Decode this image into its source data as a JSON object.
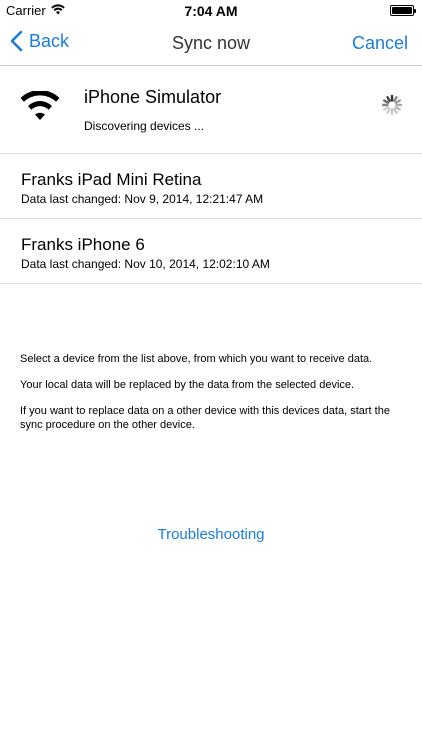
{
  "status_bar": {
    "carrier": "Carrier",
    "time": "7:04 AM",
    "battery_level": 1.0
  },
  "nav": {
    "back_label": "Back",
    "title": "Sync now",
    "cancel_label": "Cancel"
  },
  "current_device": {
    "name": "iPhone Simulator",
    "status": "Discovering devices ..."
  },
  "devices": [
    {
      "name": "Franks iPad Mini Retina",
      "last_changed": "Data last changed: Nov 9, 2014, 12:21:47 AM"
    },
    {
      "name": "Franks iPhone 6",
      "last_changed": "Data last changed: Nov 10, 2014, 12:02:10 AM"
    }
  ],
  "instructions": [
    "Select a device from the list above, from which you want to receive data.",
    "Your local data will be replaced by the data from the selected device.",
    "If you want to replace data on a other device with this devices data, start the sync procedure on the other device."
  ],
  "troubleshooting_label": "Troubleshooting",
  "colors": {
    "accent": "#1a7ddc",
    "separator": "#dcdcdc"
  }
}
